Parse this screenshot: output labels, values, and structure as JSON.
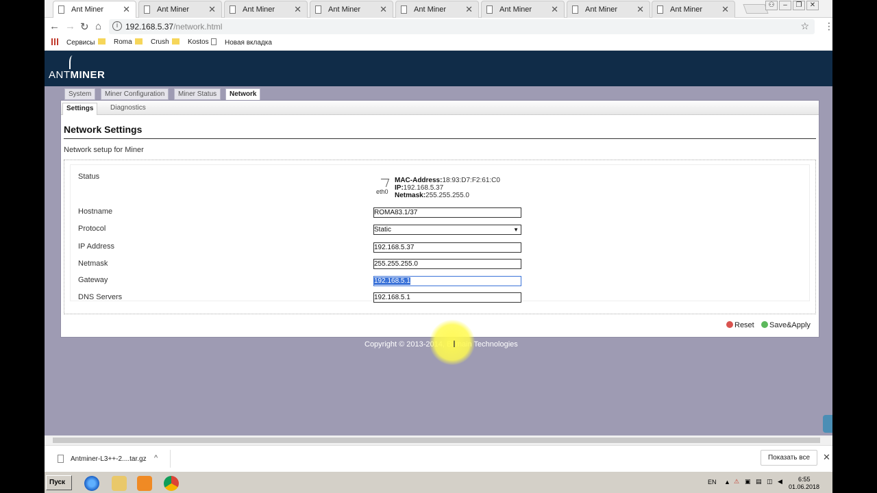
{
  "browser": {
    "tabs": [
      {
        "label": "Ant Miner",
        "active": true
      },
      {
        "label": "Ant Miner",
        "active": false
      },
      {
        "label": "Ant Miner",
        "active": false
      },
      {
        "label": "Ant Miner",
        "active": false
      },
      {
        "label": "Ant Miner",
        "active": false
      },
      {
        "label": "Ant Miner",
        "active": false
      },
      {
        "label": "Ant Miner",
        "active": false
      },
      {
        "label": "Ant Miner",
        "active": false
      }
    ],
    "url": {
      "host": "192.168.5.37",
      "path": "/network.html"
    },
    "bookmarks": [
      "Сервисы",
      "Roma",
      "Crush",
      "Kostos",
      "Новая вкладка"
    ]
  },
  "app": {
    "logo": {
      "part1": "ANT",
      "part2": "MINER"
    },
    "main_tabs": [
      "System",
      "Miner Configuration",
      "Miner Status",
      "Network"
    ],
    "active_main_tab": "Network",
    "sub_tabs": [
      "Settings",
      "Diagnostics"
    ],
    "active_sub_tab": "Settings",
    "section_title": "Network Settings",
    "section_desc": "Network setup for Miner",
    "status": {
      "label": "Status",
      "interface": "eth0",
      "mac_label": "MAC-Address:",
      "mac_value": "18:93:D7:F2:61:C0",
      "ip_label": "IP:",
      "ip_value": "192.168.5.37",
      "netmask_label": "Netmask:",
      "netmask_value": "255.255.255.0"
    },
    "fields": {
      "hostname": {
        "label": "Hostname",
        "value": "ROMA83.1/37"
      },
      "protocol": {
        "label": "Protocol",
        "value": "Static"
      },
      "ip_address": {
        "label": "IP Address",
        "value": "192.168.5.37"
      },
      "netmask": {
        "label": "Netmask",
        "value": "255.255.255.0"
      },
      "gateway": {
        "label": "Gateway",
        "value": "192.168.5.1"
      },
      "dns": {
        "label": "DNS Servers",
        "value": "192.168.5.1"
      }
    },
    "buttons": {
      "reset": "Reset",
      "save_apply": "Save&Apply"
    },
    "copyright": "Copyright © 2013-2014, Bitmain Technologies"
  },
  "downloads": {
    "file_name": "Antminer-L3++-2....tar.gz",
    "show_all": "Показать все"
  },
  "taskbar": {
    "start": "Пуск",
    "lang": "EN",
    "time": "6:55",
    "date": "01.06.2018"
  },
  "colors": {
    "header_bg": "#102c48",
    "page_bg": "#9e9bb3",
    "selection": "#3a72d8",
    "highlight": "#fffa50"
  }
}
